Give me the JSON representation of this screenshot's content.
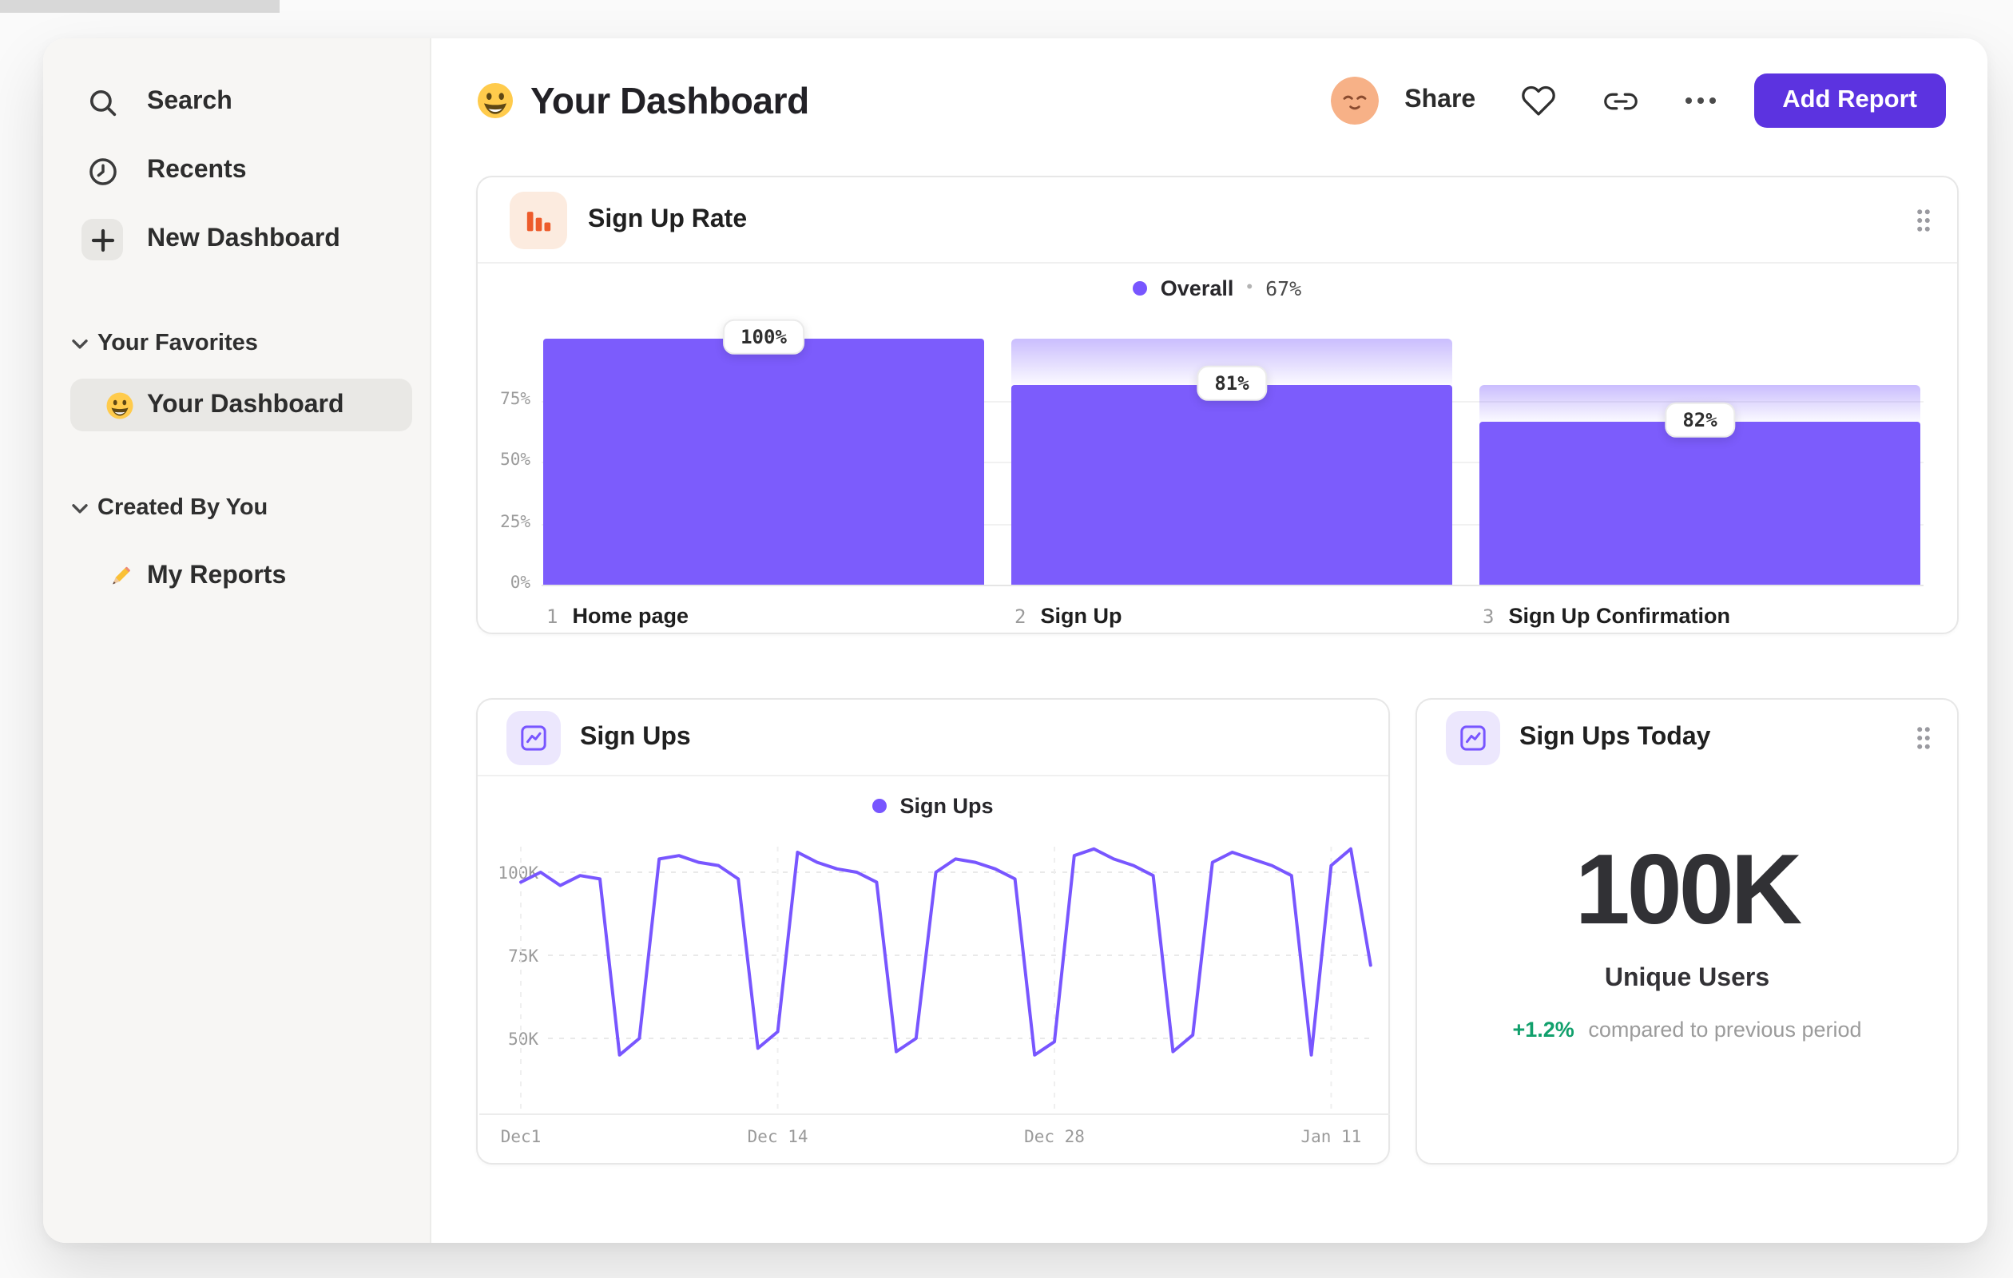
{
  "sidebar": {
    "search_label": "Search",
    "recents_label": "Recents",
    "new_dashboard_label": "New Dashboard",
    "sections": [
      {
        "label": "Your Favorites",
        "items": [
          {
            "label": "Your Dashboard",
            "selected": true
          }
        ]
      },
      {
        "label": "Created By You",
        "items": [
          {
            "label": "My Reports",
            "selected": false
          }
        ]
      }
    ]
  },
  "header": {
    "title": "Your Dashboard",
    "share_label": "Share",
    "add_report_label": "Add Report"
  },
  "cards": {
    "sign_ups_today": {
      "title": "Sign Ups Today",
      "value": "100K",
      "metric_label": "Unique Users",
      "delta": "+1.2%",
      "delta_note": "compared to previous period"
    }
  },
  "chart_data": [
    {
      "id": "sign_up_rate_funnel",
      "type": "bar",
      "title": "Sign Up Rate",
      "legend": {
        "name": "Overall",
        "separator": "•",
        "value": "67%"
      },
      "ylim": [
        0,
        100
      ],
      "grid": true,
      "y_ticks": [
        {
          "label": "75%",
          "value": 75
        },
        {
          "label": "50%",
          "value": 50
        },
        {
          "label": "25%",
          "value": 25
        },
        {
          "label": "0%",
          "value": 0
        }
      ],
      "categories": [
        "1 Home page",
        "2 Sign Up",
        "3 Sign Up Confirmation"
      ],
      "steps": [
        {
          "index": "1",
          "name": "Home page",
          "label": "100%",
          "step_conversion_pct": 100,
          "absolute_pct": 100
        },
        {
          "index": "2",
          "name": "Sign Up",
          "label": "81%",
          "step_conversion_pct": 81,
          "absolute_pct": 81
        },
        {
          "index": "3",
          "name": "Sign Up Confirmation",
          "label": "82%",
          "step_conversion_pct": 82,
          "absolute_pct": 66
        }
      ]
    },
    {
      "id": "sign_ups_line",
      "type": "line",
      "title": "Sign Ups",
      "legend": "Sign Ups",
      "unit": "K",
      "ylim": [
        40,
        110
      ],
      "grid": true,
      "legend_position": "top-center",
      "y_ticks": [
        {
          "label": "100K",
          "value": 100
        },
        {
          "label": "75K",
          "value": 75
        },
        {
          "label": "50K",
          "value": 50
        }
      ],
      "x_ticks": [
        {
          "label": "Dec1",
          "day": 0
        },
        {
          "label": "Dec 14",
          "day": 13
        },
        {
          "label": "Dec 28",
          "day": 27
        },
        {
          "label": "Jan 11",
          "day": 41
        }
      ],
      "series": [
        {
          "name": "Sign Ups",
          "values": [
            97,
            100,
            96,
            99,
            98,
            45,
            50,
            104,
            105,
            103,
            102,
            98,
            47,
            52,
            106,
            103,
            101,
            100,
            97,
            46,
            50,
            100,
            104,
            103,
            101,
            98,
            45,
            49,
            105,
            107,
            104,
            102,
            99,
            46,
            51,
            103,
            106,
            104,
            102,
            99,
            45,
            102,
            107,
            72
          ]
        }
      ]
    }
  ],
  "icons": {
    "search": "magnifier",
    "recents": "clock",
    "new_dashboard": "plus",
    "section_toggle": "chevron-down",
    "your_dashboard": "grinning-face-emoji",
    "my_reports": "pencil-emoji",
    "avatar": "relieved-face",
    "favorite": "heart-outline",
    "copy_link": "link",
    "more": "ellipsis-dots",
    "card_drag": "drag-handle-dots",
    "sign_up_rate_card": "orange-bar-chart",
    "sign_ups_card": "purple-line-chart"
  },
  "colors": {
    "accent": "#7856FF",
    "funnel_bar": "#7C5CFC",
    "button": "#5C33E0",
    "positive": "#11A06C",
    "funnel_icon": "#ED5B2B"
  }
}
